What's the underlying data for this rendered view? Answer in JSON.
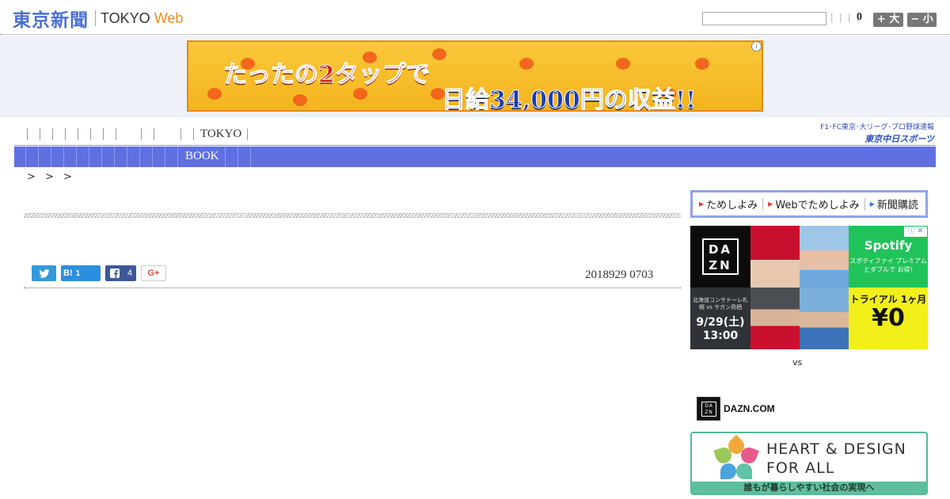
{
  "header": {
    "logo_main": "東京新聞",
    "logo_tokyo": "TOKYO",
    "logo_web": "Web",
    "search_placeholder": "",
    "bars": "| | | |",
    "count": "0",
    "font_plus": "+ 大",
    "font_minus": "− 小"
  },
  "banner": {
    "line1": "たったの2タップで",
    "line2": "日給34,000円の収益!!",
    "info": "i",
    "accent": "#f4b41f"
  },
  "nav1": {
    "tokyo": "TOKYO"
  },
  "sponsor": {
    "top": "F1･FC東京･大リーグ･プロ野球速報",
    "logo": "東京中日スポーツ"
  },
  "nav2": {
    "book": "BOOK",
    "color": "#6070e2"
  },
  "breadcrumb": "> > >",
  "article": {
    "date": "2018929 0703",
    "share": {
      "hatena_label": "B!",
      "hatena_count": "1",
      "facebook_count": "4",
      "gplus_label": "G+"
    }
  },
  "sidebar": {
    "trial": [
      "ためしよみ",
      "Webでためしよみ",
      "新聞購読"
    ],
    "dazn_ad": {
      "logo": "DA ZN",
      "spotify_name": "Spotify",
      "spotify_sub": "スポティファイ プレミアム とダブルで お得!",
      "match_teams": "北海道コンサドーレ札幌 vs サガン鳥栖",
      "match_day": "9/29(土)",
      "match_time": "13:00",
      "trial_text": "トライアル 1ヶ月",
      "trial_price": "¥0",
      "corner": "ⓘ ✕"
    },
    "vs": "vs",
    "dazn_com": "DAZN.COM",
    "heart": {
      "line1": "HEART & DESIGN",
      "line2": "FOR ALL",
      "bar": "誰もが暮らしやすい社会の実現へ"
    }
  }
}
